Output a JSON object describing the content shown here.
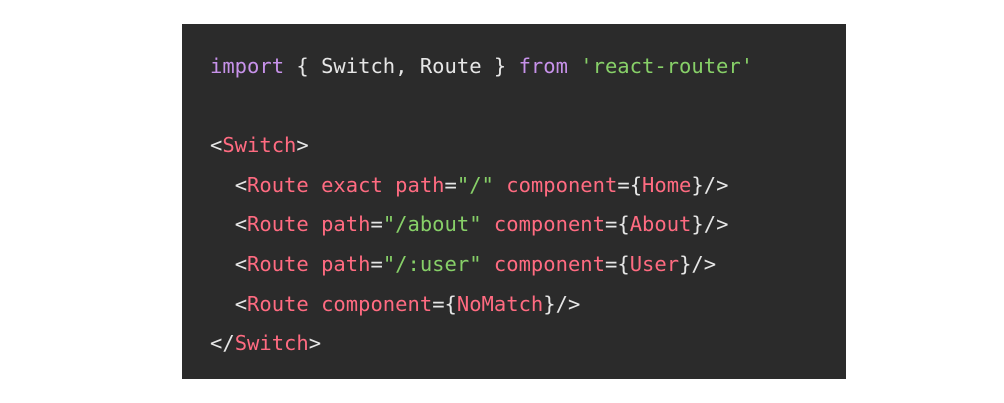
{
  "code": {
    "line1": {
      "kw_import": "import",
      "text1": " { Switch, Route } ",
      "kw_from": "from",
      "space": " ",
      "module": "'react-router'"
    },
    "line3": {
      "open_lt": "<",
      "tag": "Switch",
      "close_gt": ">"
    },
    "line4": {
      "indent": "  ",
      "lt": "<",
      "tag": "Route",
      "space1": " ",
      "attr_exact": "exact",
      "space2": " ",
      "attr_path": "path",
      "eq": "=",
      "path_val": "\"/\"",
      "space3": " ",
      "attr_component": "component",
      "eq2": "=",
      "brace_open": "{",
      "comp_name": "Home",
      "brace_close": "}",
      "self_close": "/>"
    },
    "line5": {
      "indent": "  ",
      "lt": "<",
      "tag": "Route",
      "space1": " ",
      "attr_path": "path",
      "eq": "=",
      "path_val": "\"/about\"",
      "space2": " ",
      "attr_component": "component",
      "eq2": "=",
      "brace_open": "{",
      "comp_name": "About",
      "brace_close": "}",
      "self_close": "/>"
    },
    "line6": {
      "indent": "  ",
      "lt": "<",
      "tag": "Route",
      "space1": " ",
      "attr_path": "path",
      "eq": "=",
      "path_val": "\"/:user\"",
      "space2": " ",
      "attr_component": "component",
      "eq2": "=",
      "brace_open": "{",
      "comp_name": "User",
      "brace_close": "}",
      "self_close": "/>"
    },
    "line7": {
      "indent": "  ",
      "lt": "<",
      "tag": "Route",
      "space1": " ",
      "attr_component": "component",
      "eq2": "=",
      "brace_open": "{",
      "comp_name": "NoMatch",
      "brace_close": "}",
      "self_close": "/>"
    },
    "line8": {
      "open_lt": "</",
      "tag": "Switch",
      "close_gt": ">"
    }
  },
  "colors": {
    "panel_background": "#2b2b2b",
    "keyword": "#c792ea",
    "string": "#87d068",
    "tag": "#ff6b81",
    "plain": "#e6e6e6"
  }
}
